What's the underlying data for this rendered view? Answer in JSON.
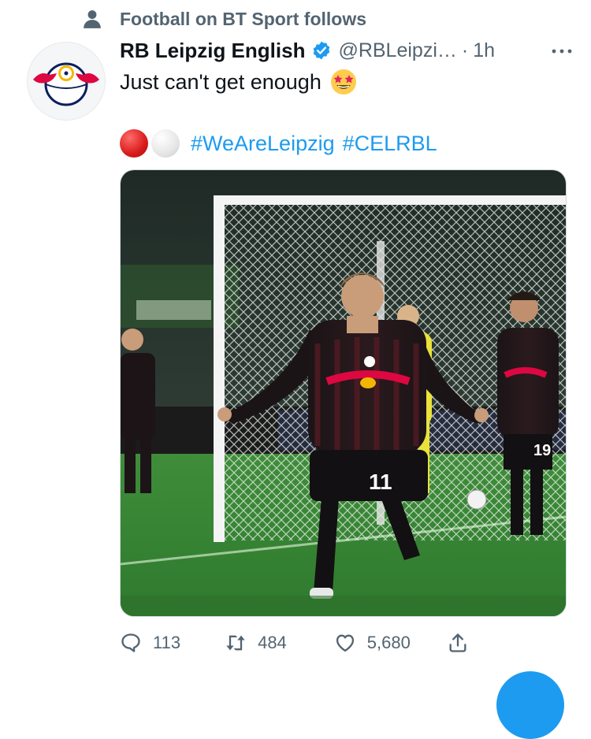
{
  "social_context": {
    "text": "Football on BT Sport follows"
  },
  "tweet": {
    "display_name": "RB Leipzig English",
    "handle": "@RBLeipzi…",
    "separator": "·",
    "timestamp": "1h",
    "text_line1": "Just can't get enough",
    "hashtags": [
      "#WeAreLeipzig",
      "#CELRBL"
    ],
    "media_shirt_number_main": "11",
    "media_shirt_number_right": "19"
  },
  "actions": {
    "replies": "113",
    "retweets": "484",
    "likes": "5,680"
  },
  "colors": {
    "accent": "#1d9bf0",
    "muted": "#536471",
    "text": "#0f1419"
  }
}
